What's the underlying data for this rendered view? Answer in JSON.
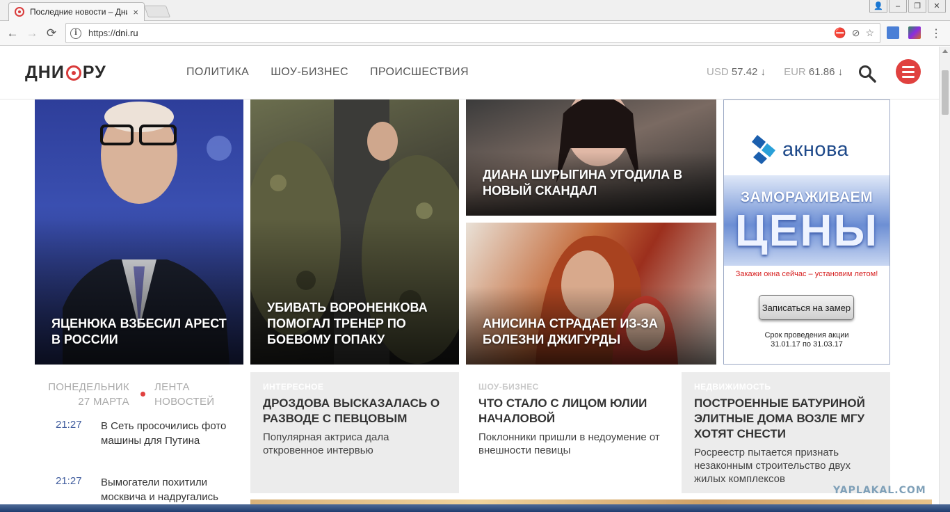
{
  "browser": {
    "tab_title": "Последние новости – Дни.ру",
    "tab_close": "×",
    "url_scheme": "https://",
    "url_host": "dni.ru",
    "window_buttons": [
      "👤",
      "–",
      "❐",
      "✕"
    ],
    "nav": {
      "back": "←",
      "forward": "→",
      "reload": "⟳",
      "menu": "⋮"
    },
    "info": "i",
    "omni_icons": [
      "⛔",
      "⊘",
      "☆"
    ]
  },
  "site": {
    "logo_left": "ДНИ",
    "logo_right": "РУ",
    "nav": [
      "ПОЛИТИКА",
      "ШОУ-БИЗНЕС",
      "ПРОИСШЕСТВИЯ"
    ],
    "rates": [
      {
        "code": "USD",
        "value": "57.42 ↓"
      },
      {
        "code": "EUR",
        "value": "61.86 ↓"
      }
    ]
  },
  "hero": [
    {
      "title": "Яценюка взбесил арест в России"
    },
    {
      "title": "Убивать Вороненкова помогал тренер по боевому гопаку"
    },
    {
      "title": "Диана Шурыгина угодила в новый скандал"
    },
    {
      "title": "Анисина страдает из-за болезни Джигурды"
    }
  ],
  "ad": {
    "brand": "акнова",
    "headline1": "ЗАМОРАЖИВАЕМ",
    "headline2": "ЦЕНЫ",
    "sub": "Закажи окна сейчас – установим летом!",
    "button": "Записаться на замер",
    "terms1": "Срок проведения акции",
    "terms2": "31.01.17 по 31.03.17"
  },
  "feed": {
    "day": "ПОНЕДЕЛЬНИК",
    "date": "27 МАРТА",
    "link1": "ЛЕНТА",
    "link2": "НОВОСТЕЙ",
    "items": [
      {
        "time": "21:27",
        "text": "В Сеть просочились фото машины для Путина"
      },
      {
        "time": "21:27",
        "text": "Вымогатели похитили москвича и надругались"
      }
    ]
  },
  "articles": [
    {
      "category": "Интересное",
      "title": "Дроздова высказалась о разводе с певцовым",
      "lead": "Популярная актриса дала откровенное интервью"
    },
    {
      "category": "Шоу-бизнес",
      "title": "Что стало с лицом Юлии Началовой",
      "lead": "Поклонники пришли в недоумение от внешности певицы"
    },
    {
      "category": "Недвижимость",
      "title": "Построенные Батуриной элитные дома возле МГУ хотят снести",
      "lead": "Росреестр пытается признать незаконным строительство двух жилых комплексов"
    }
  ],
  "watermark": "YAPLAKAL.COM",
  "colors": {
    "accent": "#e0413f",
    "time": "#3d5a9c",
    "ad_brand": "#1f4a8a"
  }
}
